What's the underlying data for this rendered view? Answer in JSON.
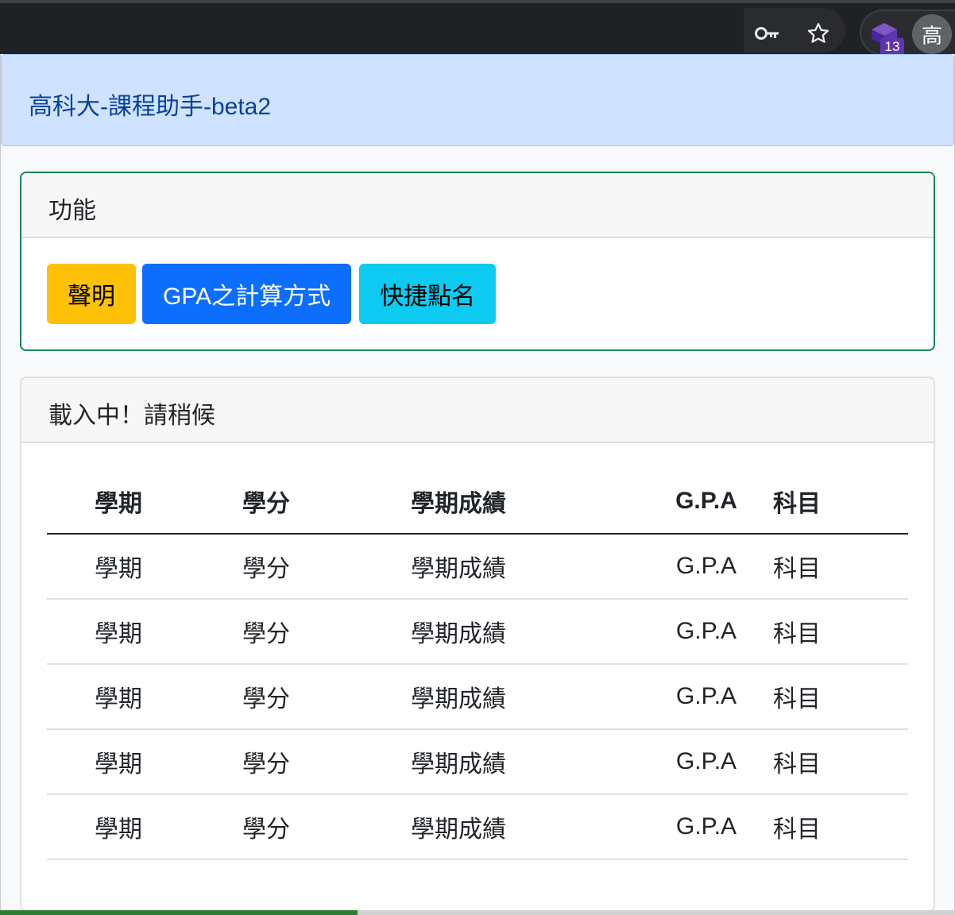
{
  "browser": {
    "icons": [
      "key-icon",
      "star-icon",
      "extension-icon"
    ],
    "extension_badge": "13",
    "profile_avatar": "高"
  },
  "header": {
    "title": "高科大-課程助手-beta2"
  },
  "functions_card": {
    "title": "功能",
    "buttons": {
      "statement": "聲明",
      "gpa_method": "GPA之計算方式",
      "quick_rollcall": "快捷點名"
    }
  },
  "grades_card": {
    "title": "載入中！請稍候",
    "columns": [
      "學期",
      "學分",
      "學期成績",
      "G.P.A",
      "科目"
    ],
    "rows": [
      [
        "學期",
        "學分",
        "學期成績",
        "G.P.A",
        "科目"
      ],
      [
        "學期",
        "學分",
        "學期成績",
        "G.P.A",
        "科目"
      ],
      [
        "學期",
        "學分",
        "學期成績",
        "G.P.A",
        "科目"
      ],
      [
        "學期",
        "學分",
        "學期成績",
        "G.P.A",
        "科目"
      ],
      [
        "學期",
        "學分",
        "學期成績",
        "G.P.A",
        "科目"
      ]
    ]
  },
  "colors": {
    "alert_bg": "#cfe2ff",
    "warning": "#ffc107",
    "primary": "#0d6efd",
    "info": "#0dcaf0",
    "success_border": "#198754"
  }
}
